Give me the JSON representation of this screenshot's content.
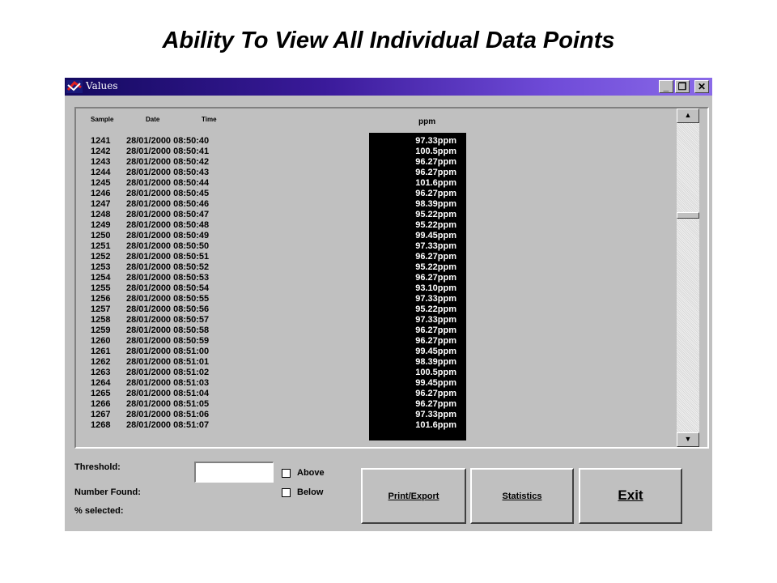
{
  "slide": {
    "title": "Ability To View All Individual Data Points"
  },
  "window": {
    "title": "Values",
    "minimize": "_",
    "restore": "❐",
    "close": "✕"
  },
  "table": {
    "headers": {
      "sample": "Sample",
      "date": "Date",
      "time": "Time",
      "ppm": "ppm"
    },
    "rows": [
      {
        "sample": "1241",
        "datetime": "28/01/2000 08:50:40",
        "value": "97.33ppm"
      },
      {
        "sample": "1242",
        "datetime": "28/01/2000 08:50:41",
        "value": "100.5ppm"
      },
      {
        "sample": "1243",
        "datetime": "28/01/2000 08:50:42",
        "value": "96.27ppm"
      },
      {
        "sample": "1244",
        "datetime": "28/01/2000 08:50:43",
        "value": "96.27ppm"
      },
      {
        "sample": "1245",
        "datetime": "28/01/2000 08:50:44",
        "value": "101.6ppm"
      },
      {
        "sample": "1246",
        "datetime": "28/01/2000 08:50:45",
        "value": "96.27ppm"
      },
      {
        "sample": "1247",
        "datetime": "28/01/2000 08:50:46",
        "value": "98.39ppm"
      },
      {
        "sample": "1248",
        "datetime": "28/01/2000 08:50:47",
        "value": "95.22ppm"
      },
      {
        "sample": "1249",
        "datetime": "28/01/2000 08:50:48",
        "value": "95.22ppm"
      },
      {
        "sample": "1250",
        "datetime": "28/01/2000 08:50:49",
        "value": "99.45ppm"
      },
      {
        "sample": "1251",
        "datetime": "28/01/2000 08:50:50",
        "value": "97.33ppm"
      },
      {
        "sample": "1252",
        "datetime": "28/01/2000 08:50:51",
        "value": "96.27ppm"
      },
      {
        "sample": "1253",
        "datetime": "28/01/2000 08:50:52",
        "value": "95.22ppm"
      },
      {
        "sample": "1254",
        "datetime": "28/01/2000 08:50:53",
        "value": "96.27ppm"
      },
      {
        "sample": "1255",
        "datetime": "28/01/2000 08:50:54",
        "value": "93.10ppm"
      },
      {
        "sample": "1256",
        "datetime": "28/01/2000 08:50:55",
        "value": "97.33ppm"
      },
      {
        "sample": "1257",
        "datetime": "28/01/2000 08:50:56",
        "value": "95.22ppm"
      },
      {
        "sample": "1258",
        "datetime": "28/01/2000 08:50:57",
        "value": "97.33ppm"
      },
      {
        "sample": "1259",
        "datetime": "28/01/2000 08:50:58",
        "value": "96.27ppm"
      },
      {
        "sample": "1260",
        "datetime": "28/01/2000 08:50:59",
        "value": "96.27ppm"
      },
      {
        "sample": "1261",
        "datetime": "28/01/2000 08:51:00",
        "value": "99.45ppm"
      },
      {
        "sample": "1262",
        "datetime": "28/01/2000 08:51:01",
        "value": "98.39ppm"
      },
      {
        "sample": "1263",
        "datetime": "28/01/2000 08:51:02",
        "value": "100.5ppm"
      },
      {
        "sample": "1264",
        "datetime": "28/01/2000 08:51:03",
        "value": "99.45ppm"
      },
      {
        "sample": "1265",
        "datetime": "28/01/2000 08:51:04",
        "value": "96.27ppm"
      },
      {
        "sample": "1266",
        "datetime": "28/01/2000 08:51:05",
        "value": "96.27ppm"
      },
      {
        "sample": "1267",
        "datetime": "28/01/2000 08:51:06",
        "value": "97.33ppm"
      },
      {
        "sample": "1268",
        "datetime": "28/01/2000 08:51:07",
        "value": "101.6ppm"
      }
    ]
  },
  "scrollbar": {
    "up": "▲",
    "down": "▼"
  },
  "controls": {
    "threshold_label": "Threshold:",
    "threshold_value": "",
    "number_found_label": "Number Found:",
    "percent_selected_label": "% selected:",
    "above_label": "Above",
    "below_label": "Below"
  },
  "buttons": {
    "print_export": "Print/Export",
    "statistics": "Statistics",
    "exit": "Exit"
  },
  "colors": {
    "titlebar_start": "#140a60",
    "titlebar_end": "#8a6ae8",
    "window_face": "#c0c0c0",
    "value_column_bg": "#000000",
    "value_text": "#ffffff"
  }
}
